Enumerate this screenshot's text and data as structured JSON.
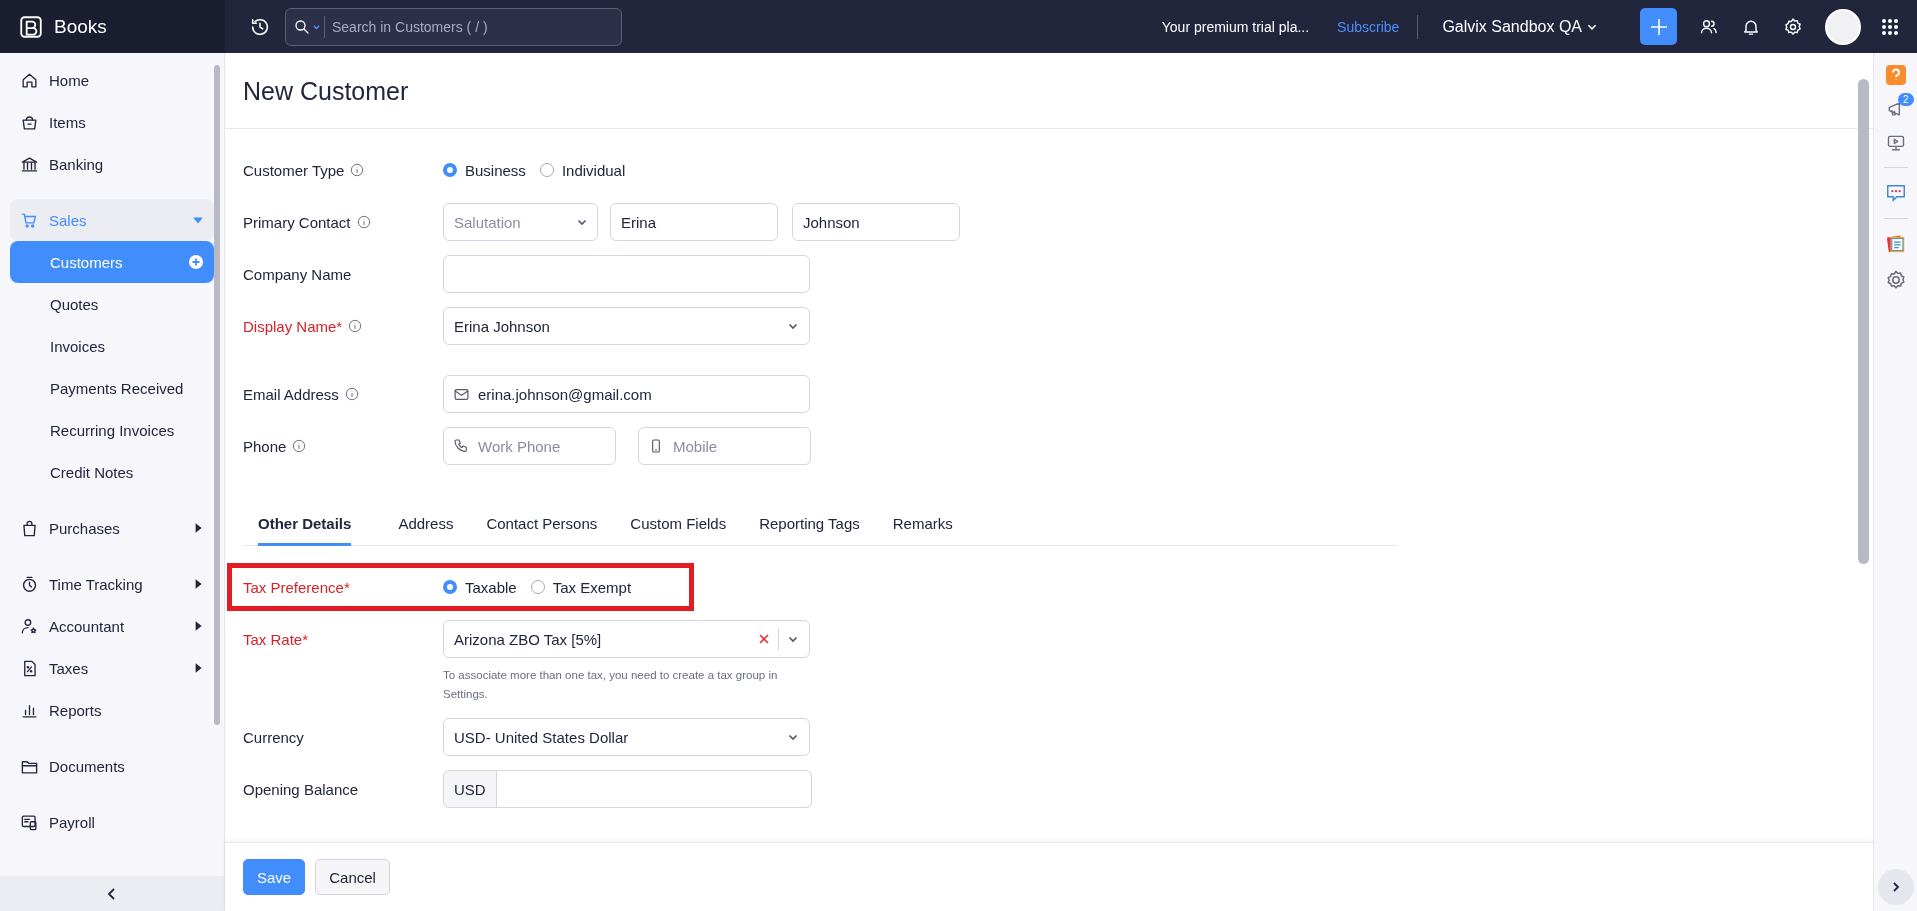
{
  "app": {
    "name": "Books"
  },
  "topbar": {
    "search_placeholder": "Search in Customers ( / )",
    "trial_text": "Your premium trial pla...",
    "subscribe_link": "Subscribe",
    "org_name": "Galvix Sandbox QA"
  },
  "sidebar": {
    "sections": [
      {
        "items": [
          {
            "label": "Home",
            "selected": false
          },
          {
            "label": "Items",
            "selected": false
          },
          {
            "label": "Banking",
            "selected": false
          }
        ]
      },
      {
        "items": [
          {
            "label": "Sales",
            "selected": false,
            "expanded": true,
            "children": [
              {
                "label": "Customers",
                "selected": true
              },
              {
                "label": "Quotes",
                "selected": false
              },
              {
                "label": "Invoices",
                "selected": false
              },
              {
                "label": "Payments Received",
                "selected": false
              },
              {
                "label": "Recurring Invoices",
                "selected": false
              },
              {
                "label": "Credit Notes",
                "selected": false
              }
            ]
          }
        ]
      },
      {
        "items": [
          {
            "label": "Purchases",
            "selected": false,
            "expanded": false
          }
        ]
      },
      {
        "items": [
          {
            "label": "Time Tracking",
            "selected": false,
            "expanded": false
          },
          {
            "label": "Accountant",
            "selected": false,
            "expanded": false
          },
          {
            "label": "Taxes",
            "selected": false,
            "expanded": false
          },
          {
            "label": "Reports",
            "selected": false
          }
        ]
      },
      {
        "items": [
          {
            "label": "Documents",
            "selected": false
          }
        ]
      },
      {
        "items": [
          {
            "label": "Payroll",
            "selected": false
          }
        ]
      }
    ]
  },
  "form": {
    "title": "New Customer",
    "fields": [
      {
        "kind": "radio",
        "label": "Customer Type",
        "info": true,
        "options": [
          {
            "label": "Business",
            "selected": true
          },
          {
            "label": "Individual",
            "selected": false
          }
        ]
      },
      {
        "kind": "name",
        "label": "Primary Contact",
        "info": true,
        "salutation_placeholder": "Salutation",
        "first_name": "Erina",
        "last_name": "Johnson"
      },
      {
        "kind": "text",
        "label": "Company Name",
        "info": false
      },
      {
        "kind": "select",
        "label": "Display Name*",
        "required": true,
        "info": true,
        "value": "Erina Johnson"
      },
      {
        "kind": "email",
        "label": "Email Address",
        "info": true,
        "value": "erina.johnson@gmail.com"
      },
      {
        "kind": "phone",
        "label": "Phone",
        "info": true,
        "work_placeholder": "Work Phone",
        "mobile_placeholder": "Mobile"
      }
    ],
    "tabs": [
      {
        "label": "Other Details",
        "selected": true
      },
      {
        "label": "Address",
        "selected": false
      },
      {
        "label": "Contact Persons",
        "selected": false
      },
      {
        "label": "Custom Fields",
        "selected": false
      },
      {
        "label": "Reporting Tags",
        "selected": false
      },
      {
        "label": "Remarks",
        "selected": false
      }
    ],
    "other_details": [
      {
        "kind": "radio",
        "label": "Tax Preference*",
        "required": true,
        "highlighted": true,
        "options": [
          {
            "label": "Taxable",
            "selected": true
          },
          {
            "label": "Tax Exempt",
            "selected": false
          }
        ]
      },
      {
        "kind": "select",
        "label": "Tax Rate*",
        "required": true,
        "value": "Arizona ZBO Tax [5%]",
        "clearable": true,
        "hint": "To associate more than one tax, you need to create a tax group in Settings."
      },
      {
        "kind": "select",
        "label": "Currency",
        "value": "USD- United States Dollar"
      },
      {
        "kind": "amount",
        "label": "Opening Balance",
        "prefix": "USD"
      }
    ],
    "buttons": [
      {
        "label": "Save",
        "kind": "primary"
      },
      {
        "label": "Cancel",
        "kind": "secondary"
      }
    ]
  },
  "right_rail": {
    "notification_count": "2"
  }
}
